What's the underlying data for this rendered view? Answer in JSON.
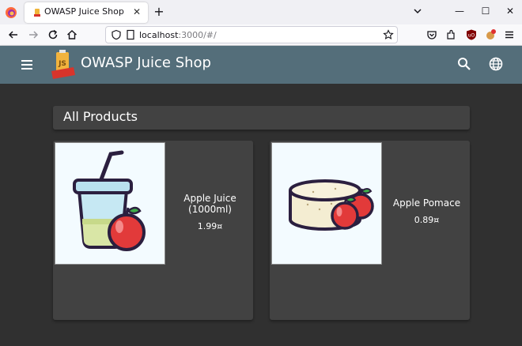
{
  "browser": {
    "tab_title": "OWASP Juice Shop",
    "tab_close": "✕",
    "new_tab": "+",
    "url_host": "localhost",
    "url_rest": ":3000/#/",
    "window_controls": {
      "minimize": "—",
      "maximize": "☐",
      "close": "✕"
    }
  },
  "app": {
    "title": "OWASP Juice Shop",
    "heading": "All Products",
    "toolbar_color": "#546e7a",
    "background_color": "#303030",
    "card_color": "#424242"
  },
  "products": [
    {
      "name": "Apple Juice (1000ml)",
      "price": "1.99¤",
      "image_icon": "apple-juice-illustration"
    },
    {
      "name": "Apple Pomace",
      "price": "0.89¤",
      "image_icon": "apple-pomace-illustration"
    }
  ]
}
